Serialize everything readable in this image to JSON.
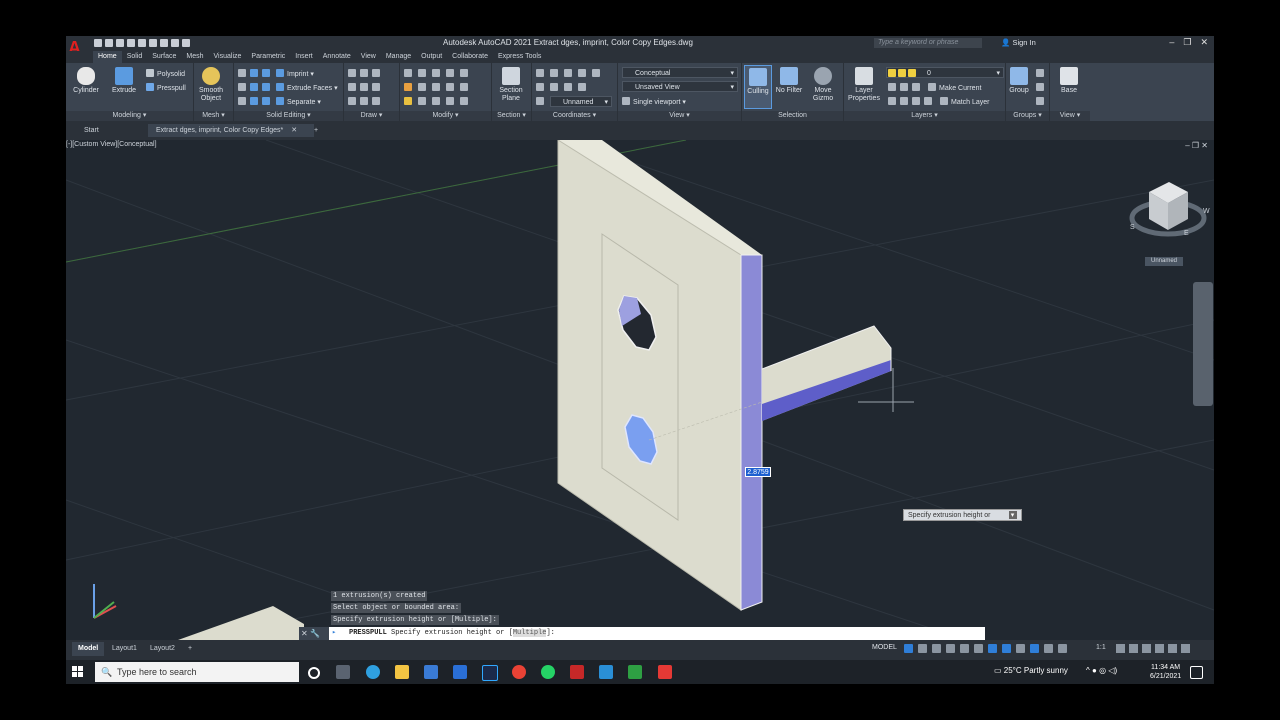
{
  "app": {
    "title": "Autodesk AutoCAD 2021   Extract dges, imprint, Color Copy Edges.dwg",
    "search_placeholder": "Type a keyword or phrase",
    "sign_in": "Sign In"
  },
  "ribbon_tabs": [
    "Home",
    "Solid",
    "Surface",
    "Mesh",
    "Visualize",
    "Parametric",
    "Insert",
    "Annotate",
    "View",
    "Manage",
    "Output",
    "Collaborate",
    "Express Tools"
  ],
  "ribbon": {
    "modeling": {
      "title": "Modeling",
      "cylinder": "Cylinder",
      "extrude": "Extrude",
      "polysolid": "Polysolid",
      "presspull": "Presspull"
    },
    "mesh": {
      "title": "Mesh",
      "smooth_object": "Smooth Object"
    },
    "solid_editing": {
      "title": "Solid Editing",
      "imprint": "Imprint",
      "extrude_faces": "Extrude Faces",
      "separate": "Separate"
    },
    "draw": {
      "title": "Draw"
    },
    "modify": {
      "title": "Modify"
    },
    "section": {
      "title": "Section",
      "section_plane": "Section Plane"
    },
    "coordinates": {
      "title": "Coordinates",
      "ucs": "Unnamed"
    },
    "view": {
      "title": "View",
      "visual_style": "Conceptual",
      "saved_view": "Unsaved View",
      "viewport": "Single viewport"
    },
    "selection": {
      "title": "Selection",
      "culling": "Culling",
      "no_filter": "No Filter",
      "move_gizmo": "Move Gizmo"
    },
    "layers": {
      "title": "Layers",
      "layer_properties": "Layer Properties",
      "layer_name": "0",
      "make_current": "Make Current",
      "match_layer": "Match Layer"
    },
    "groups": {
      "title": "Groups",
      "group": "Group"
    },
    "viewgroup": {
      "title": "View",
      "base": "Base"
    }
  },
  "file_tabs": {
    "start": "Start",
    "active": "Extract dges, imprint, Color Copy Edges*"
  },
  "viewport": {
    "label": "[-][Custom View][Conceptual]",
    "dimension_value": "2.8759",
    "tooltip": "Specify extrusion height or",
    "viewcube_label": "Unnamed",
    "compass": {
      "s": "S",
      "e": "E",
      "w": "W"
    }
  },
  "command": {
    "history": [
      "1 extrusion(s) created",
      "Select object or bounded area:",
      "Specify extrusion height or [Multiple]:"
    ],
    "prompt_cmd": "PRESSPULL",
    "prompt_text": " Specify extrusion height or [",
    "prompt_option": "Multiple",
    "prompt_end": "]:"
  },
  "status": {
    "layouts": [
      "Model",
      "Layout1",
      "Layout2"
    ],
    "model_button": "MODEL",
    "scale": "1:1"
  },
  "taskbar": {
    "search_placeholder": "Type here to search",
    "weather": "25°C  Partly sunny",
    "time": "11:34 AM",
    "date": "6/21/2021"
  },
  "colors": {
    "accent": "#2f7ed8",
    "face": "#dcdcce",
    "side": "#8b8ad6",
    "logo": "#e02020"
  }
}
